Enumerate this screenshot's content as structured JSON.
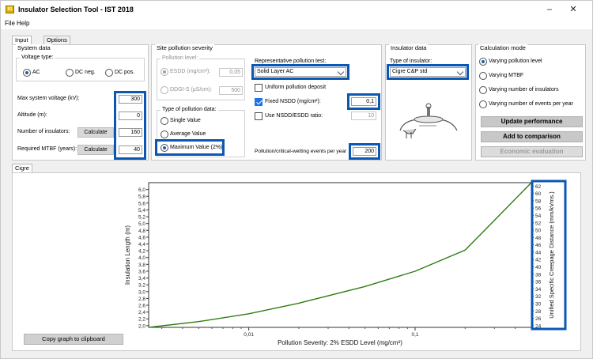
{
  "window": {
    "title": "Insulator Selection Tool - IST 2018",
    "app_icon": "IG",
    "minimize": "–",
    "close": "✕"
  },
  "menu": [
    "File",
    "Help"
  ],
  "top_tabs": [
    "Input data",
    "Options"
  ],
  "system_data": {
    "title": "System data",
    "voltage_type": {
      "title": "Voltage type:",
      "options": [
        "AC",
        "DC neg.",
        "DC pos."
      ],
      "selected": "AC"
    },
    "fields": [
      {
        "label": "Max system voltage (kV):",
        "value": "300",
        "button": ""
      },
      {
        "label": "Altitude (m):",
        "value": "0",
        "button": ""
      },
      {
        "label": "Number of insulators:",
        "value": "160",
        "button": "Calculate"
      },
      {
        "label": "Required MTBF (years):",
        "value": "40",
        "button": "Calculate"
      }
    ]
  },
  "site_pollution": {
    "title": "Site pollution severity",
    "level_group": {
      "title": "Pollution level:",
      "esdd_label": "ESDD (mg/cm²):",
      "esdd_value": "0,05",
      "ddgis_label": "DDGI-S (µS/cm):",
      "ddgis_value": "500"
    },
    "type_group": {
      "title": "Type of pollution data:",
      "options": [
        "Single Value",
        "Average Value",
        "Maximum Value (2%)"
      ],
      "selected": "Maximum Value (2%)"
    },
    "rep_test_label": "Representative pollution test:",
    "rep_test_value": "Solid Layer AC",
    "uniform_label": "Uniform pollution deposit",
    "fixed_nsdd_label": "Fixed NSDD (mg/cm²):",
    "fixed_nsdd_value": "0,1",
    "ratio_label": "Use NSDD/ESDD ratio:",
    "ratio_value": "10",
    "events_label": "Pollution/critical-wetting events per year",
    "events_value": "200"
  },
  "insulator_data": {
    "title": "Insulator data",
    "type_label": "Type of insulator:",
    "type_value": "Cigre C&P std"
  },
  "calc_mode": {
    "title": "Calculation mode",
    "options": [
      "Varying pollution level",
      "Varying MTBF",
      "Varying number of insulators",
      "Varying number of events per year"
    ],
    "selected": "Varying pollution level",
    "buttons": [
      "Update performance",
      "Add to comparison",
      "Economic evaluation"
    ]
  },
  "result_tab": "Cigre CP std",
  "copy_button": "Copy graph to clipboard",
  "chart_data": {
    "type": "line",
    "xlabel": "Pollution Severity: 2% ESDD Level (mg/cm²)",
    "ylabel": "Insulation Length (m)",
    "y2label": "Unified Specific Creepage Distance (mm/kVms.)",
    "x_scale": "log",
    "x_ticks": [
      "0,01",
      "0,1"
    ],
    "xlim": [
      0.0025,
      0.5
    ],
    "ylim": [
      1.95,
      6.2
    ],
    "y_ticks": [
      "2,0",
      "2,2",
      "2,4",
      "2,6",
      "2,8",
      "3,0",
      "3,2",
      "3,4",
      "3,6",
      "3,8",
      "4,0",
      "4,2",
      "4,4",
      "4,6",
      "4,8",
      "5,0",
      "5,2",
      "5,4",
      "5,6",
      "5,8",
      "6,0"
    ],
    "y2_ticks": [
      "24",
      "26",
      "28",
      "30",
      "32",
      "34",
      "36",
      "38",
      "40",
      "42",
      "44",
      "46",
      "48",
      "50",
      "52",
      "54",
      "56",
      "58",
      "60",
      "62"
    ],
    "series": [
      {
        "color": "#2e7d14",
        "x": [
          0.0025,
          0.005,
          0.01,
          0.02,
          0.05,
          0.1,
          0.2,
          0.5
        ],
        "y": [
          1.95,
          2.12,
          2.35,
          2.66,
          3.15,
          3.6,
          4.22,
          6.2
        ]
      }
    ],
    "grid": false
  }
}
